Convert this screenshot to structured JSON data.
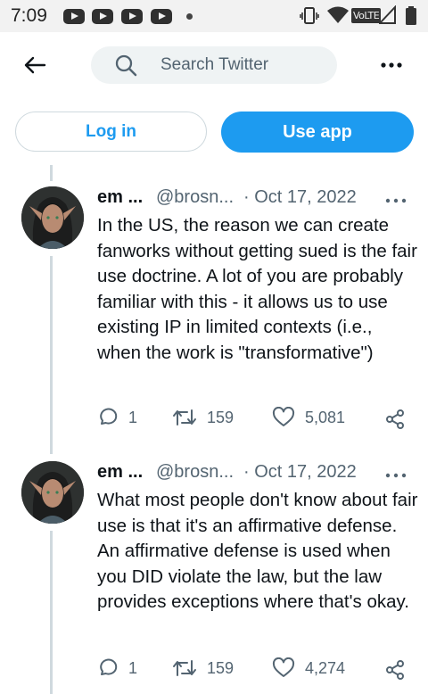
{
  "status_bar": {
    "time": "7:09",
    "network_label": "VoLTE",
    "icons": [
      "youtube-icon",
      "youtube-icon",
      "youtube-icon",
      "youtube-icon",
      "more-notifications-dot",
      "vibrate-icon",
      "wifi-icon",
      "signal-icon",
      "battery-icon"
    ]
  },
  "header": {
    "back_icon": "arrow-left-icon",
    "search_placeholder": "Search Twitter",
    "more_icon": "more-horizontal-icon"
  },
  "auth": {
    "login_label": "Log in",
    "use_app_label": "Use app"
  },
  "colors": {
    "accent": "#1d9bf0",
    "text_primary": "#0f1419",
    "text_secondary": "#536471",
    "thread_line": "#cfd9de"
  },
  "tweets": [
    {
      "name": "em ...",
      "handle": "@brosn...",
      "date": "· Oct 17, 2022",
      "text": "In the US, the reason we can create fanworks without getting sued is the fair use doctrine. A lot of you are probably familiar with this - it allows us to use existing IP in limited contexts (i.e., when the work is \"transformative\")",
      "replies": "1",
      "retweets": "159",
      "likes": "5,081"
    },
    {
      "name": "em ...",
      "handle": "@brosn...",
      "date": "· Oct 17, 2022",
      "text": "What most people don't know about fair use is that it's an affirmative defense. An affirmative defense is used when you DID violate the law, but the law provides exceptions where that's okay.",
      "replies": "1",
      "retweets": "159",
      "likes": "4,274"
    }
  ]
}
